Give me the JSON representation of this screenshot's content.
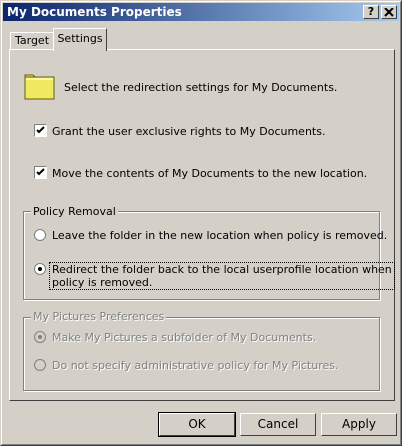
{
  "window": {
    "title": "My Documents Properties",
    "help_button": "?",
    "close_button": "✕"
  },
  "tabs": [
    {
      "label": "Target",
      "active": false
    },
    {
      "label": "Settings",
      "active": true
    }
  ],
  "settings": {
    "intro_text": "Select the redirection settings for My Documents.",
    "grant_rights": {
      "checked": true,
      "label": "Grant the user exclusive rights to My Documents."
    },
    "move_contents": {
      "checked": true,
      "label": "Move the contents of My Documents to the new location."
    }
  },
  "policy_removal": {
    "title": "Policy Removal",
    "options": [
      {
        "label": "Leave the folder in the new location when policy is removed.",
        "selected": false
      },
      {
        "label_line1": "Redirect the folder back to the local userprofile location when",
        "label_line2": "policy is removed.",
        "selected": true
      }
    ]
  },
  "my_pictures": {
    "title": "My Pictures Preferences",
    "enabled": false,
    "options": [
      {
        "label": "Make My Pictures a subfolder of My Documents.",
        "selected": true
      },
      {
        "label": "Do not specify administrative policy for My Pictures.",
        "selected": false
      }
    ]
  },
  "buttons": {
    "ok": "OK",
    "cancel": "Cancel",
    "apply": "Apply"
  },
  "colors": {
    "title_start": "#0a246a",
    "title_end": "#a6caf0",
    "face": "#d4d0c8",
    "folder": "#f0e860"
  }
}
